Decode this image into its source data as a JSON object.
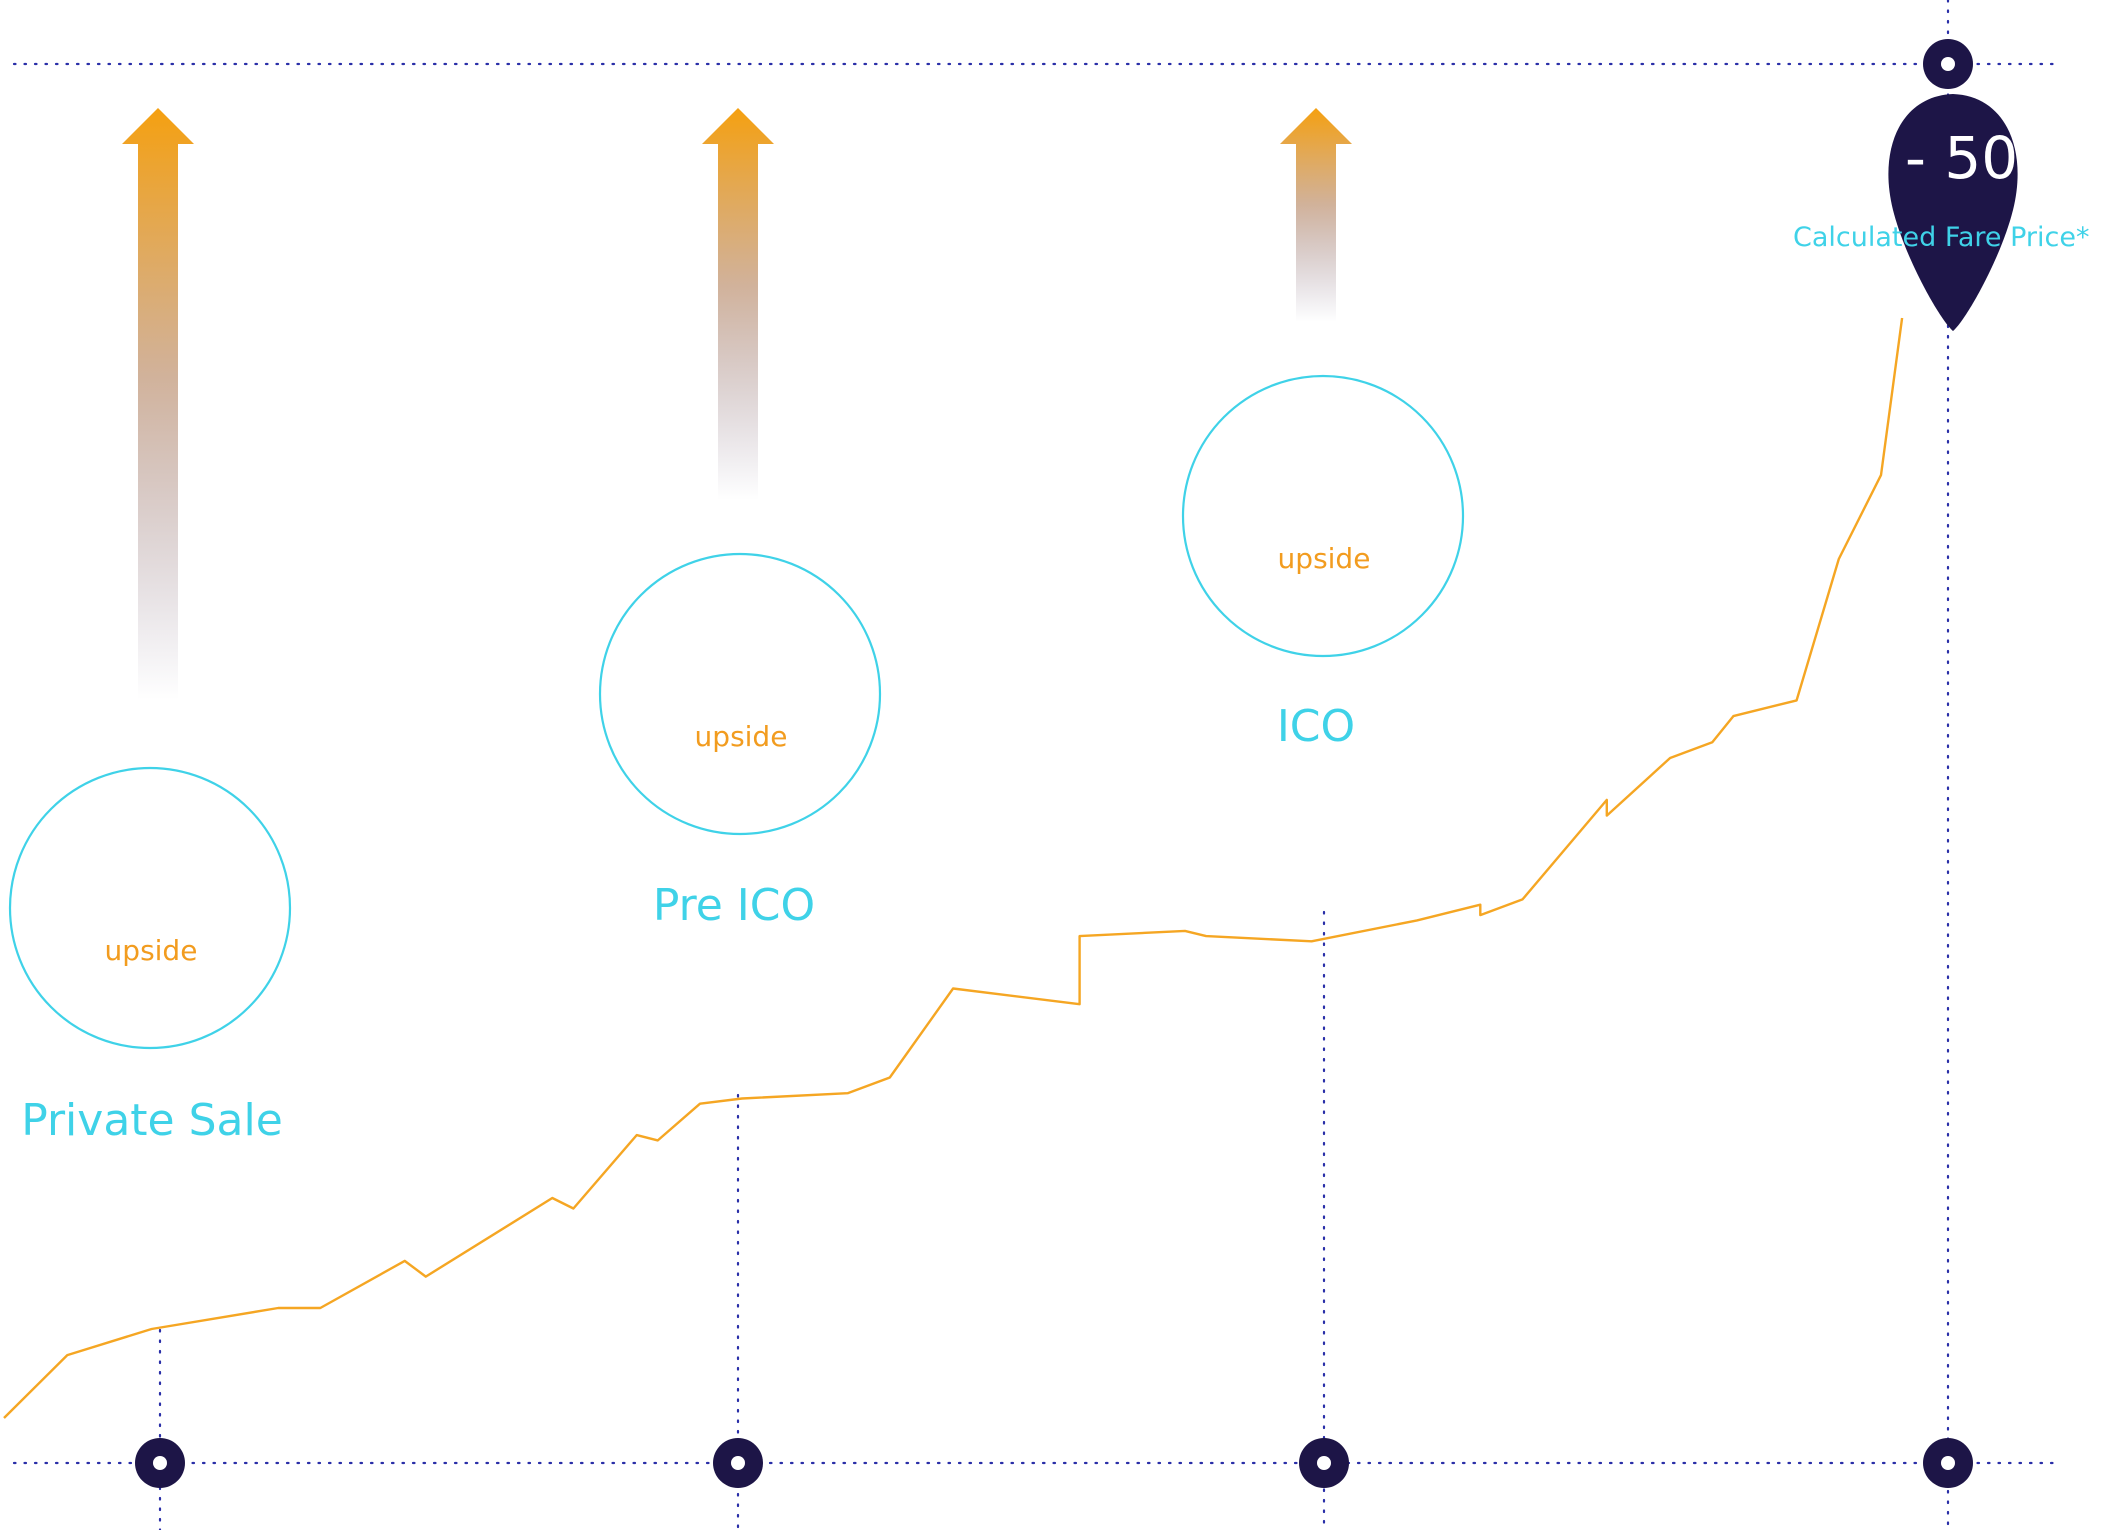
{
  "chart_data": {
    "type": "line",
    "stages": [
      {
        "name": "Private Sale",
        "badge": "upside"
      },
      {
        "name": "Pre ICO",
        "badge": "upside"
      },
      {
        "name": "ICO",
        "badge": "upside"
      }
    ],
    "final": {
      "value_text": "- 50",
      "label": "Calculated Fare Price*"
    },
    "grid": "dotted",
    "title": "",
    "xlabel": "",
    "ylabel": "",
    "series": [
      {
        "name": "",
        "x": [
          0,
          0.03,
          0.07,
          0.13,
          0.15,
          0.19,
          0.2,
          0.26,
          0.27,
          0.3,
          0.31,
          0.33,
          0.35,
          0.4,
          0.42,
          0.45,
          0.51,
          0.51,
          0.56,
          0.57,
          0.62,
          0.67,
          0.7,
          0.7,
          0.72,
          0.76,
          0.76,
          0.79,
          0.81,
          0.82,
          0.85,
          0.87,
          0.89,
          0.9
        ],
        "y": [
          0,
          12,
          17,
          21,
          21,
          30,
          27,
          42,
          40,
          54,
          53,
          60,
          61,
          62,
          65,
          82,
          79,
          92,
          93,
          92,
          91,
          95,
          98,
          96,
          99,
          118,
          115,
          126,
          129,
          134,
          137,
          164,
          180,
          210
        ]
      }
    ],
    "colors": {
      "line": "#f5a623",
      "circle": "#3fd2e8",
      "stage_text": "#3fd2e8",
      "badge_text": "#f29c1f",
      "marker": "#1d1547",
      "grid": "#2a2fa8",
      "arrow_top": "#f5a010"
    }
  }
}
